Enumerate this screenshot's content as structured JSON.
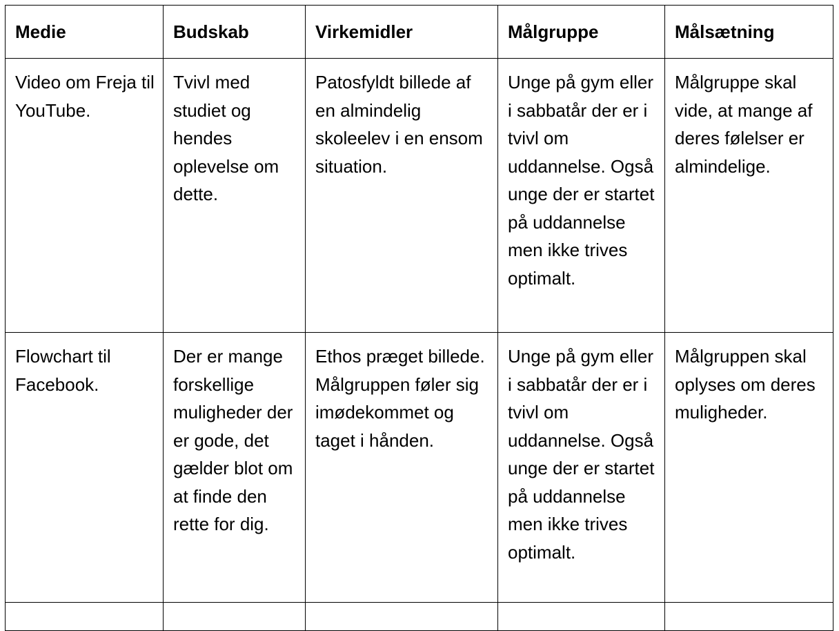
{
  "table": {
    "headers": [
      "Medie",
      "Budskab",
      "Virkemidler",
      "Målgruppe",
      "Målsætning"
    ],
    "rows": [
      [
        "Video om Freja til YouTube.",
        "Tvivl med studiet og hendes oplevelse om dette.",
        "Patosfyldt billede af en almindelig skoleelev i en ensom situation.",
        "Unge på gym eller i sabbatår der er i tvivl om uddannelse. Også unge der er startet på uddannelse men ikke trives optimalt.",
        "Målgruppe skal vide, at mange af deres følelser er almindelige."
      ],
      [
        "Flowchart til Facebook.",
        "Der er mange forskellige muligheder der er gode, det gælder blot om at finde den rette for dig.",
        "Ethos præget billede. Målgruppen føler sig imødekommet og taget i hånden.",
        "Unge på gym eller i sabbatår der er i tvivl om uddannelse. Også unge der er startet på uddannelse men ikke trives optimalt.",
        "Målgruppen skal oplyses om deres muligheder."
      ],
      [
        "",
        "",
        "",
        "",
        ""
      ]
    ]
  }
}
